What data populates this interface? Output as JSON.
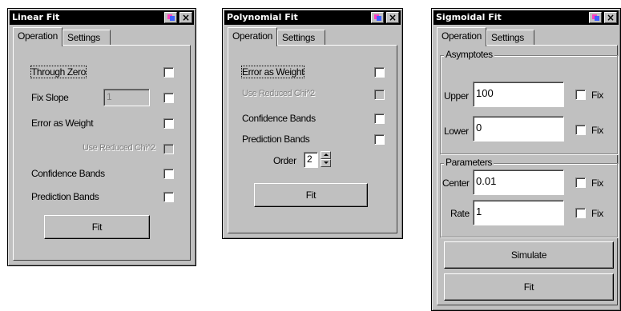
{
  "linear": {
    "title": "Linear Fit",
    "tabs": [
      "Operation",
      "Settings"
    ],
    "rows": {
      "through_zero": "Through Zero",
      "fix_slope": "Fix Slope",
      "fix_slope_value": "1",
      "error_weight": "Error as Weight",
      "use_reduced": "Use Reduced Chi^2",
      "confidence": "Confidence Bands",
      "prediction": "Prediction Bands"
    },
    "fit_label": "Fit"
  },
  "poly": {
    "title": "Polynomial Fit",
    "tabs": [
      "Operation",
      "Settings"
    ],
    "rows": {
      "error_weight": "Error as Weight",
      "use_reduced": "Use Reduced Chi^2",
      "confidence": "Confidence Bands",
      "prediction": "Prediction Bands"
    },
    "order_label": "Order",
    "order_value": "2",
    "fit_label": "Fit"
  },
  "sigmoid": {
    "title": "Sigmoidal Fit",
    "tabs": [
      "Operation",
      "Settings"
    ],
    "asymptotes_title": "Asymptotes",
    "upper_label": "Upper",
    "upper_value": "100",
    "lower_label": "Lower",
    "lower_value": "0",
    "parameters_title": "Parameters",
    "center_label": "Center",
    "center_value": "0.01",
    "rate_label": "Rate",
    "rate_value": "1",
    "fix_label": "Fix",
    "simulate_label": "Simulate",
    "fit_label": "Fit"
  },
  "colors": {
    "face": "#c0c0c0",
    "title_bg": "#000000",
    "title_fg": "#ffffff"
  }
}
